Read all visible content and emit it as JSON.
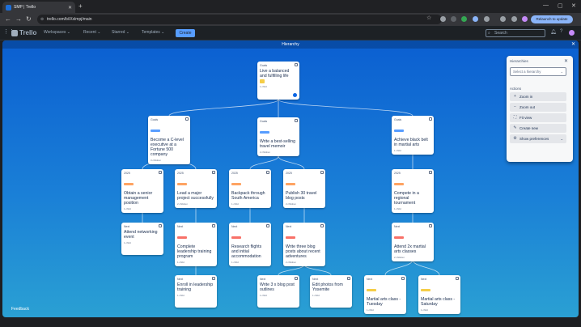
{
  "browser": {
    "tab_title": "SMP | Trello",
    "url": "trello.com/b/iXxlmpj/main",
    "relaunch_label": "Relaunch to update"
  },
  "header": {
    "logo": "Trello",
    "menus": [
      "Workspaces",
      "Recent",
      "Starred",
      "Templates"
    ],
    "create_label": "Create",
    "search_placeholder": "Search"
  },
  "board": {
    "title": "Hierarchy",
    "feedback_label": "Feedback"
  },
  "colors": {
    "accent": "#579dff",
    "label_red": "#f87168",
    "label_orange": "#fea362",
    "label_blue": "#579dff",
    "label_yellow": "#f5cd47"
  },
  "cards": [
    {
      "id": "root",
      "list": "Goals",
      "title": "Live a balanced and fulfilling life",
      "meta": "1 child",
      "label": "",
      "emoji": true,
      "dot": true
    },
    {
      "id": "c1",
      "list": "Goals",
      "title": "Become a C-level executive at a Fortune 500 company",
      "meta": "3 children",
      "label": "blue"
    },
    {
      "id": "c2",
      "list": "Goals",
      "title": "Write a best-selling travel memoir",
      "meta": "2 children",
      "label": "blue"
    },
    {
      "id": "c3",
      "list": "Goals",
      "title": "Achieve black belt in martial arts",
      "meta": "1 child",
      "label": "blue"
    },
    {
      "id": "d1",
      "list": "2025",
      "title": "Obtain a senior management position",
      "meta": "1 child",
      "label": "orange"
    },
    {
      "id": "d2",
      "list": "2025",
      "title": "Lead a major project successfully",
      "meta": "2 children",
      "label": "orange"
    },
    {
      "id": "d3",
      "list": "2025",
      "title": "Backpack through South America",
      "meta": "1 child",
      "label": "orange"
    },
    {
      "id": "d4",
      "list": "2025",
      "title": "Publish 30 travel blog posts",
      "meta": "2 children",
      "label": "orange"
    },
    {
      "id": "d5",
      "list": "2025",
      "title": "Compete in a regional tournament",
      "meta": "1 child",
      "label": "orange"
    },
    {
      "id": "e1",
      "list": "Next",
      "title": "Attend networking event",
      "meta": "1 child",
      "label": ""
    },
    {
      "id": "e2",
      "list": "Next",
      "title": "Complete leadership training program",
      "meta": "1 child",
      "label": "red"
    },
    {
      "id": "e3",
      "list": "Next",
      "title": "Research flights and initial accommodation",
      "meta": "1 child",
      "label": "red"
    },
    {
      "id": "e4",
      "list": "Next",
      "title": "Write three blog posts about recent adventures",
      "meta": "2 children",
      "label": "red"
    },
    {
      "id": "e5",
      "list": "Next",
      "title": "Attend 2x martial arts classes",
      "meta": "2 children",
      "label": "red"
    },
    {
      "id": "f1",
      "list": "Next",
      "title": "Enroll in leadership training",
      "meta": "1 child",
      "label": ""
    },
    {
      "id": "f2",
      "list": "Next",
      "title": "Write 3 x blog post outlines",
      "meta": "1 child",
      "label": ""
    },
    {
      "id": "f3",
      "list": "Next",
      "title": "Edit photos from Yosemite",
      "meta": "1 child",
      "label": ""
    },
    {
      "id": "f4",
      "list": "Next",
      "title": "Martial arts class - Tuesday",
      "meta": "1 child",
      "label": "yellow"
    },
    {
      "id": "f5",
      "list": "Next",
      "title": "Martial arts class - Saturday",
      "meta": "1 child",
      "label": "yellow"
    }
  ],
  "panel": {
    "title": "Hierarchies",
    "select_placeholder": "Select a hierarchy",
    "actions_label": "Actions",
    "actions": [
      {
        "label": "Zoom in",
        "icon": "+"
      },
      {
        "label": "Zoom out",
        "icon": "−"
      },
      {
        "label": "Fit view",
        "icon": "⛶"
      },
      {
        "label": "Create new",
        "icon": "✎"
      },
      {
        "label": "Show preferences",
        "icon": "⚙"
      }
    ]
  }
}
